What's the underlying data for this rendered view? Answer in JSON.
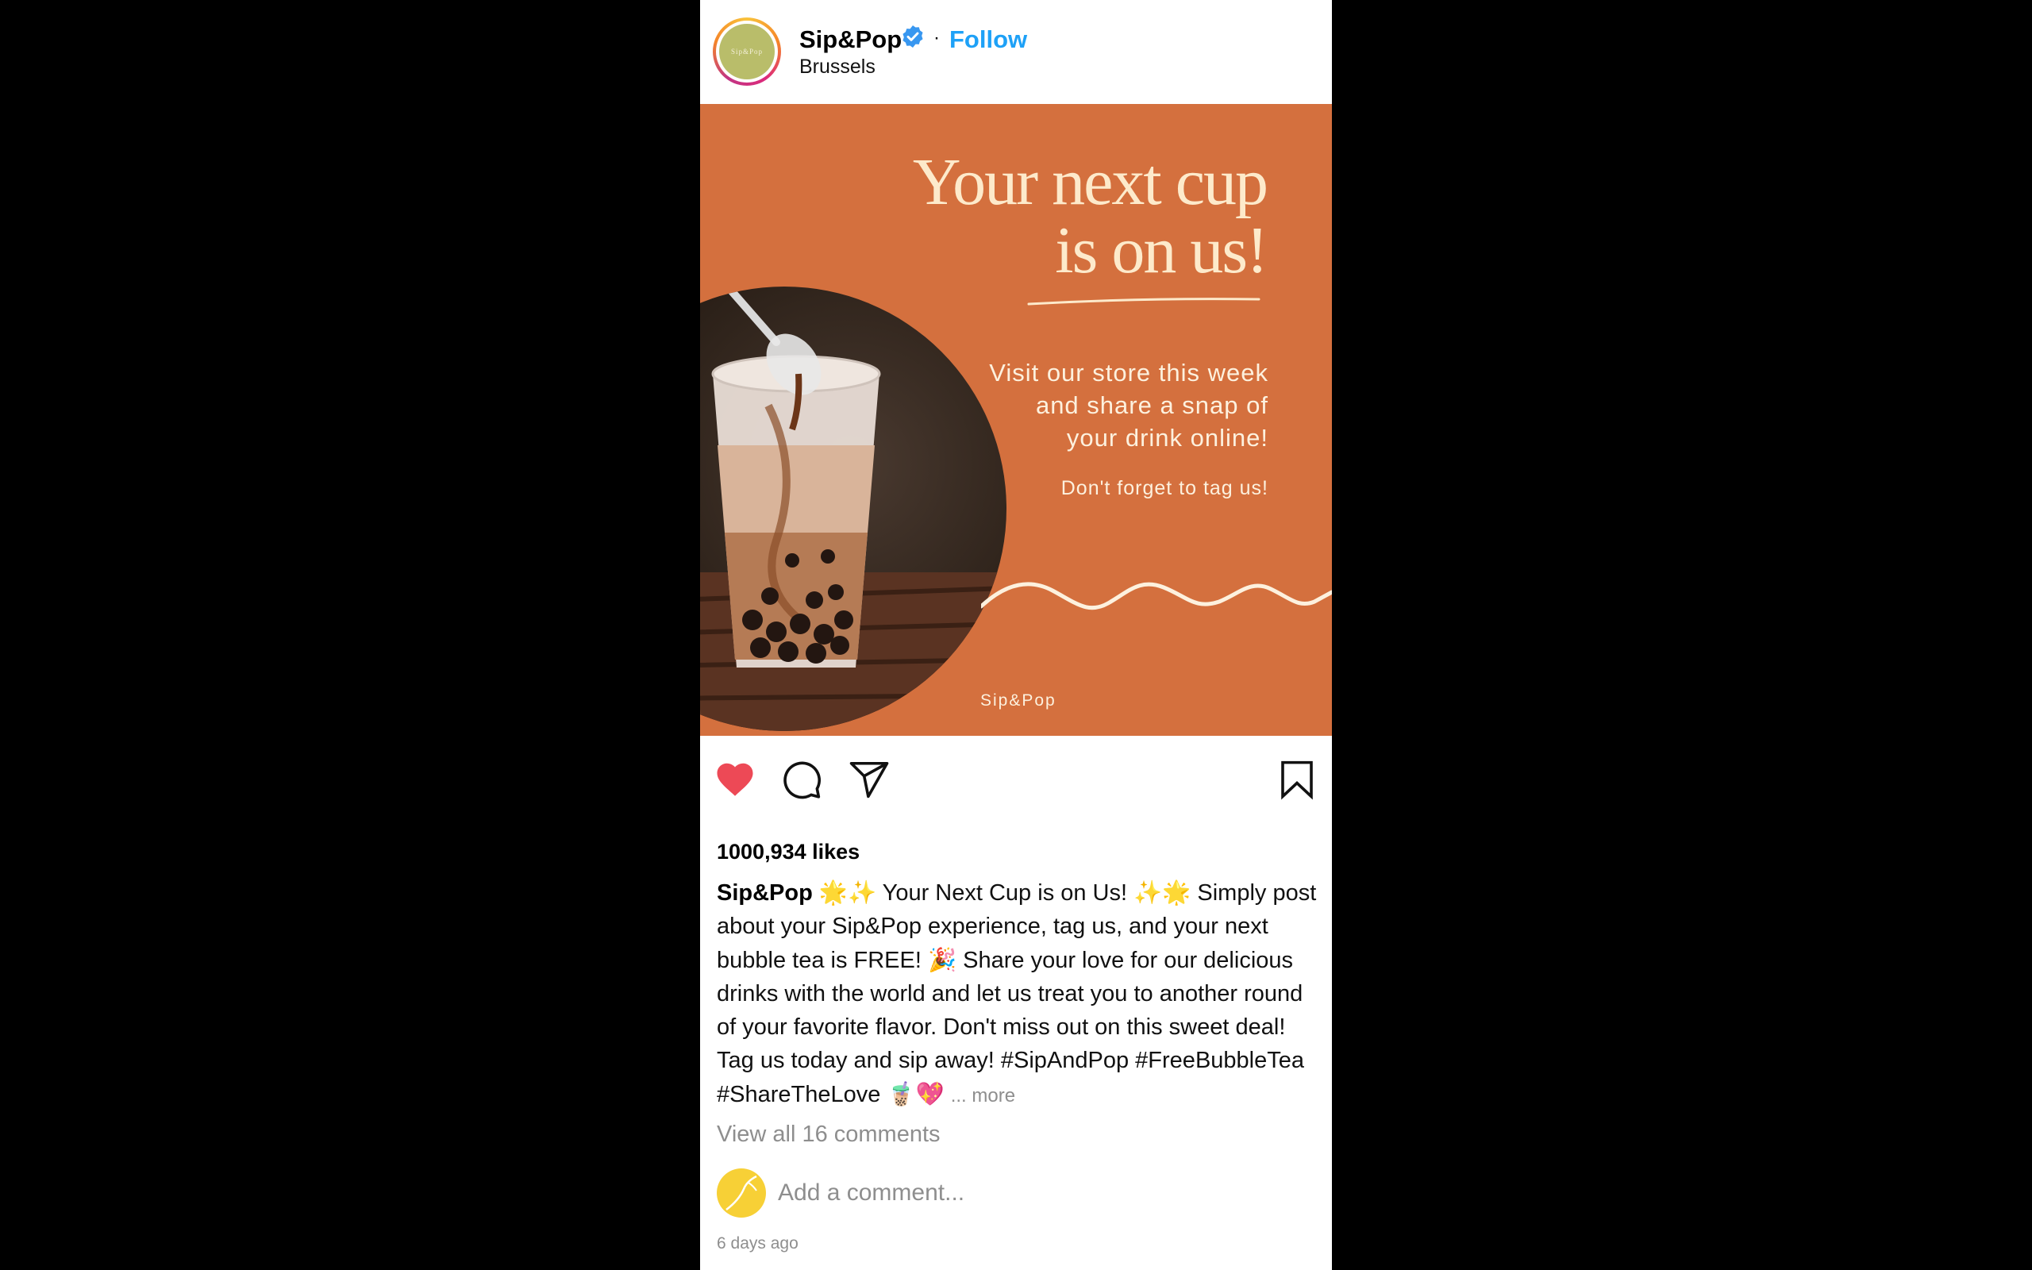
{
  "account": {
    "username": "Sip&Pop",
    "avatar_text": "Sip&Pop",
    "follow_label": "Follow",
    "separator": "·",
    "location": "Brussels"
  },
  "image": {
    "headline_line1": "Your next cup",
    "headline_line2": "is on us!",
    "visit_line1": "Visit our store this week",
    "visit_line2": "and share a snap of",
    "visit_line3": "your drink online!",
    "tagline": "Don't forget to tag us!",
    "watermark": "Sip&Pop"
  },
  "likes": "1000,934 likes",
  "caption": {
    "author": "Sip&Pop",
    "text": " 🌟✨ Your Next Cup is on Us! ✨🌟 Simply post about your Sip&Pop experience, tag us, and your next bubble tea is FREE! 🎉 Share your love for our delicious drinks with the world and let us treat you to another round of your favorite flavor. Don't miss out on this sweet deal! Tag us today and sip away! #SipAndPop #FreeBubbleTea #ShareTheLove 🧋💖 ",
    "more": "... more"
  },
  "view_comments": "View all 16 comments",
  "comment_placeholder": "Add a comment...",
  "timestamp": "6 days ago",
  "colors": {
    "accent": "#d4703e",
    "follow": "#1ea1f7",
    "like": "#ed4956"
  },
  "icons": [
    "verified-badge-icon",
    "heart-icon",
    "comment-icon",
    "share-icon",
    "bookmark-icon"
  ]
}
